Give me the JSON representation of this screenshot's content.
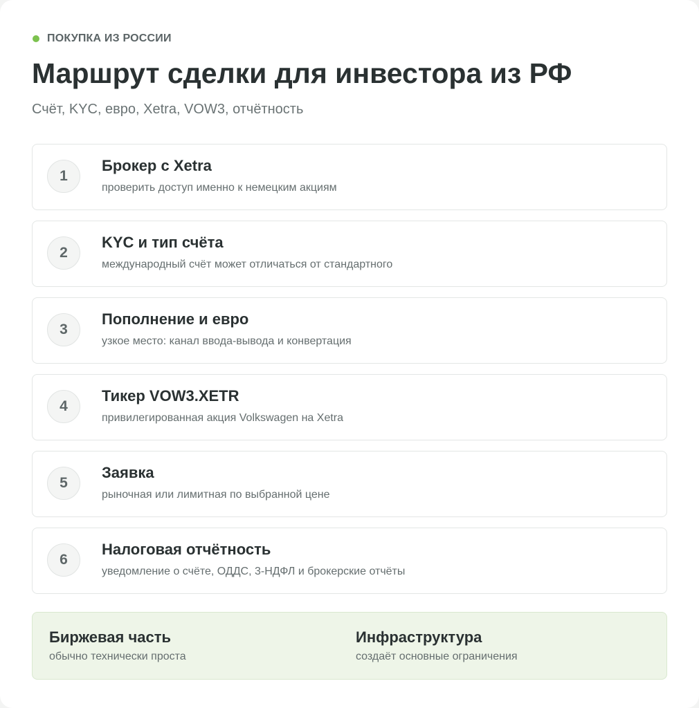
{
  "header": {
    "eyebrow": "ПОКУПКА ИЗ РОССИИ",
    "title": "Маршрут сделки для инвестора из РФ",
    "subtitle": "Счёт, KYC, евро, Xetra, VOW3, отчётность"
  },
  "steps": [
    {
      "number": "1",
      "title": "Брокер с Xetra",
      "description": "проверить доступ именно к немецким акциям"
    },
    {
      "number": "2",
      "title": "KYC и тип счёта",
      "description": "международный счёт может отличаться от стандартного"
    },
    {
      "number": "3",
      "title": "Пополнение и евро",
      "description": "узкое место: канал ввода-вывода и конвертация"
    },
    {
      "number": "4",
      "title": "Тикер VOW3.XETR",
      "description": "привилегированная акция Volkswagen на Xetra"
    },
    {
      "number": "5",
      "title": "Заявка",
      "description": "рыночная или лимитная по выбранной цене"
    },
    {
      "number": "6",
      "title": "Налоговая отчётность",
      "description": "уведомление о счёте, ОДДС, 3-НДФЛ и брокерские отчёты"
    }
  ],
  "summary": {
    "left": {
      "title": "Биржевая часть",
      "description": "обычно технически проста"
    },
    "right": {
      "title": "Инфраструктура",
      "description": "создаёт основные ограничения"
    }
  },
  "colors": {
    "accent_dot": "#7cc24e",
    "summary_background": "#eef5e8"
  }
}
